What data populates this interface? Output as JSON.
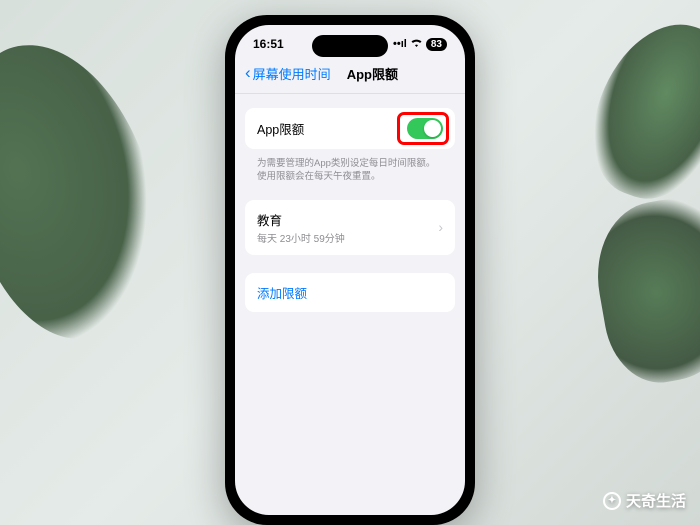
{
  "status": {
    "time": "16:51",
    "battery": "83"
  },
  "nav": {
    "back_label": "屏幕使用时间",
    "title": "App限额"
  },
  "app_limit_cell": {
    "label": "App限额",
    "footer": "为需要管理的App类别设定每日时间限额。使用限额会在每天午夜重置。"
  },
  "category_cell": {
    "label": "教育",
    "detail": "每天 23小时 59分钟"
  },
  "add_limit": {
    "label": "添加限额"
  },
  "watermark": {
    "text": "天奇生活"
  }
}
